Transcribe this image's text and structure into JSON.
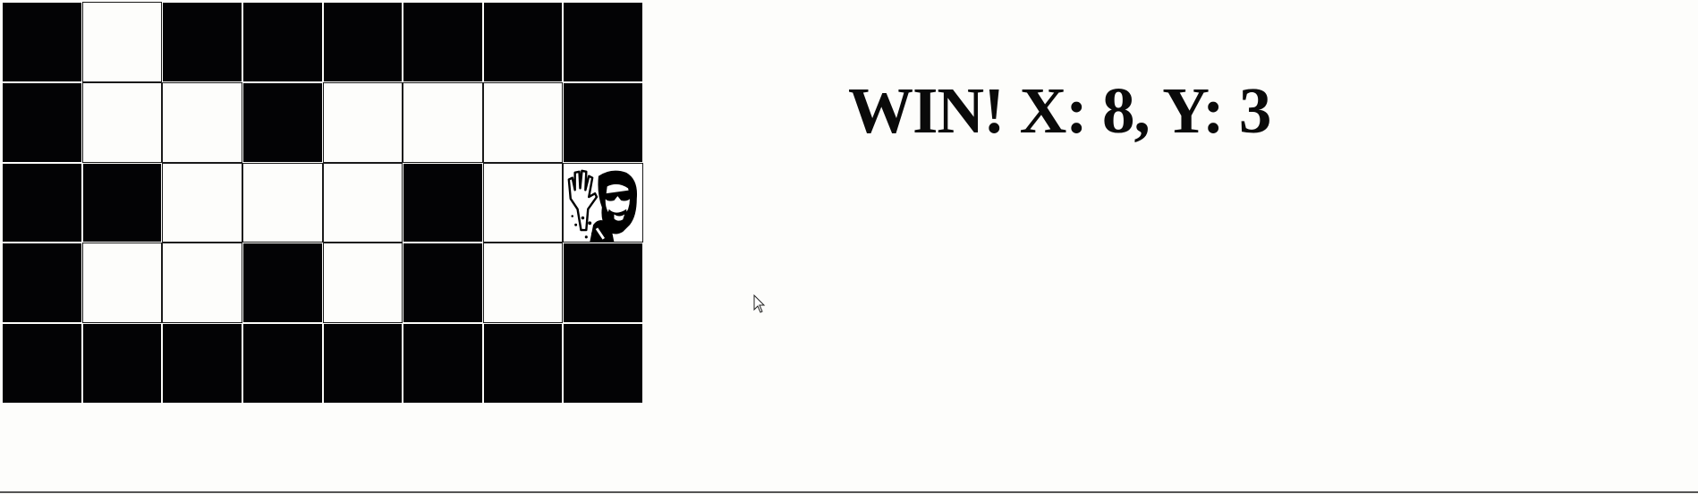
{
  "game": {
    "status_text": "WIN! X: 8, Y: 3",
    "player_position": {
      "x": 8,
      "y": 3
    },
    "columns": 8,
    "rows": 5,
    "maze": [
      [
        1,
        0,
        1,
        1,
        1,
        1,
        1,
        1
      ],
      [
        1,
        0,
        0,
        1,
        0,
        0,
        0,
        1
      ],
      [
        1,
        1,
        0,
        0,
        0,
        1,
        0,
        2
      ],
      [
        1,
        0,
        0,
        1,
        0,
        1,
        0,
        1
      ],
      [
        1,
        1,
        1,
        1,
        1,
        1,
        1,
        1
      ]
    ],
    "legend": {
      "0": "open",
      "1": "wall",
      "2": "player"
    },
    "player_icon": "waving-man-with-sunglasses-icon",
    "colors": {
      "wall": "#030305",
      "open": "#fdfdfb",
      "background": "#fdfdfb",
      "text": "#0a0a0a"
    }
  }
}
